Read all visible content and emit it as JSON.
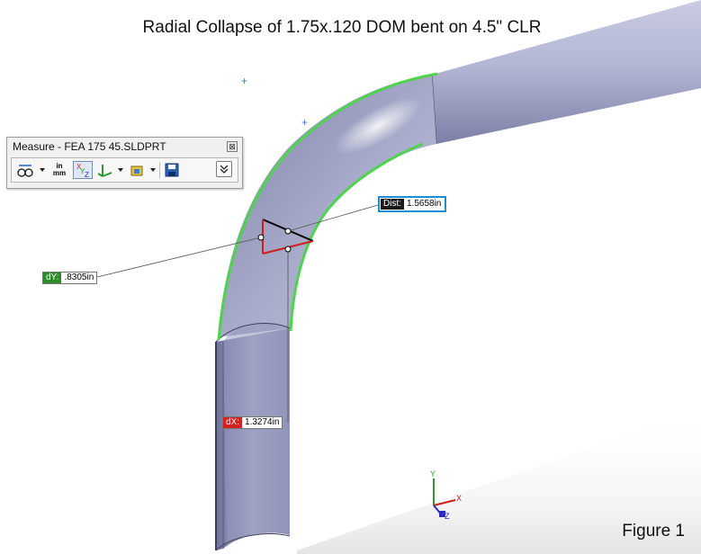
{
  "title": "Radial Collapse of 1.75x.120 DOM bent on 4.5\" CLR",
  "figure_label": "Figure 1",
  "measure_panel": {
    "title": "Measure - FEA 175 45.SLDPRT",
    "close_icon": "close-icon",
    "toolbar": {
      "arc_circle_icon": "arc-circle-measure-icon",
      "units_icon_top": "in",
      "units_icon_bottom": "mm",
      "xyz_icon": "xyz-delta-icon",
      "point_projection_icon": "point-projection-icon",
      "coordinate_system_icon": "coordinate-system-icon",
      "save_icon": "save-icon",
      "expand_icon": "expand-icon"
    }
  },
  "measurements": {
    "dist_label": "Dist:",
    "dist_value": "1.5658in",
    "dy_label": "dY:",
    "dy_value": ".8305in",
    "dx_label": "dX:",
    "dx_value": "1.3274in"
  },
  "triad": {
    "x_label": "X",
    "y_label": "Y",
    "z_label": "Z"
  },
  "colors": {
    "edge_highlight": "#4fd34f",
    "dist_border": "#1a8fd4",
    "dy_tag": "#2e8a2a",
    "dx_tag": "#d32020",
    "tube": "#a9acc9"
  }
}
